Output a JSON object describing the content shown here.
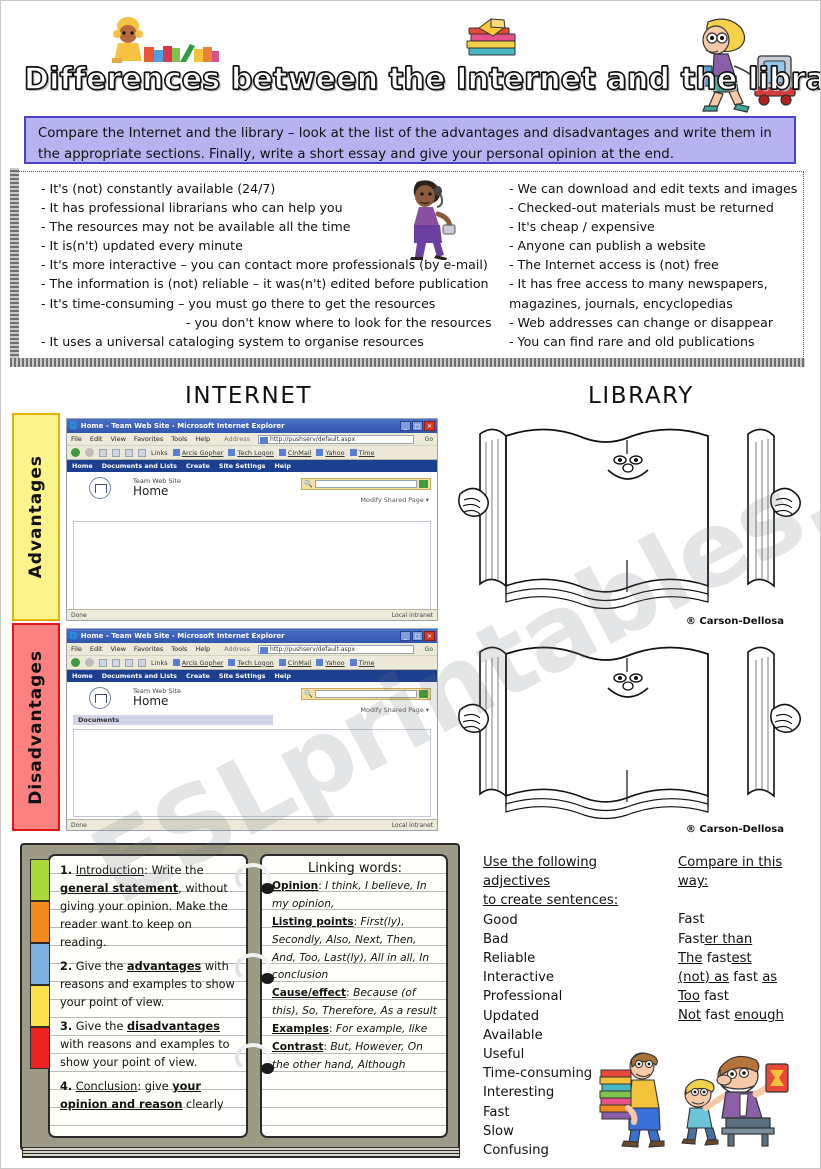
{
  "title": "Differences between the Internet and the library",
  "instructions": "Compare the Internet and the library – look at the list of the advantages and disadvantages and write them in the appropriate sections. Finally, write a short essay and give your personal opinion at the end.",
  "watermark": "ESLprintables.com",
  "board": {
    "left_items": [
      "- It's (not) constantly available (24/7)",
      "- It has professional librarians who can help you",
      "- The resources may not be available all the time",
      "- It is(n't) updated every minute",
      "- It's more interactive – you can contact more professionals (by e-mail)",
      "- The information is (not) reliable – it was(n't) edited before publication",
      "- It's time-consuming – you must go there to get the resources",
      "- you don't know where to look for the resources",
      "- It uses a universal cataloging system to organise resources"
    ],
    "right_items": [
      "- We can download and edit texts and images",
      "- Checked-out materials must be returned",
      "- It's cheap / expensive",
      "- Anyone can publish a  website",
      "- The Internet access is (not) free",
      "- It has free access to many newspapers, magazines, journals, encyclopedias",
      "- Web addresses can change or disappear",
      "- You can find rare and old publications"
    ]
  },
  "sections": {
    "internet_heading": "INTERNET",
    "library_heading": "LIBRARY",
    "advantages_label": "Advantages",
    "disadvantages_label": "Disadvantages"
  },
  "browser": {
    "window_title": "Home - Team Web Site - Microsoft Internet Explorer",
    "minimize": "_",
    "maximize": "□",
    "close": "✕",
    "menu": [
      "File",
      "Edit",
      "View",
      "Favorites",
      "Tools",
      "Help"
    ],
    "address_label": "Address",
    "address_value": "http://pushserv/default.aspx",
    "go_label": "Go",
    "links_label": "Links",
    "toolbar_links": [
      "Arcis Gopher",
      "Tech Logon",
      "CinMail",
      "Yahoo",
      "Time"
    ],
    "nav_items": [
      "Home",
      "Documents and Lists",
      "Create",
      "Site Settings",
      "Help"
    ],
    "site_small": "Team Web Site",
    "site_large": "Home",
    "modify_link": "Modify Shared Page ▾",
    "documents_header": "Documents",
    "status_left": "Done",
    "status_right": "Local intranet"
  },
  "book_credit": "® Carson-Dellosa",
  "notebook": {
    "tab_colors": [
      "#a9d93a",
      "#f08a1e",
      "#7eb0e0",
      "#fce14a",
      "#ef2222"
    ],
    "steps": [
      {
        "num": "1.",
        "lead": "Introduction",
        "text_a": ": Write the ",
        "bold": "general statement",
        "text_b": ", without giving your opinion. Make the reader want to keep on reading."
      },
      {
        "num": "2.",
        "lead": "",
        "text_a": "Give the ",
        "bold": "advantages",
        "text_b": " with reasons and examples to show your point of view."
      },
      {
        "num": "3.",
        "lead": "",
        "text_a": "Give the ",
        "bold": "disadvantages",
        "text_b": " with reasons and examples to show your point of view."
      },
      {
        "num": "4.",
        "lead": "Conclusion",
        "text_a": ": give ",
        "bold": "your opinion and reason",
        "text_b": " clearly"
      }
    ],
    "linking_title": "Linking words:",
    "linking": [
      {
        "label": "Opinion",
        "items": "I think, I believe, In my opinion,"
      },
      {
        "label": "Listing points",
        "items": "First(ly), Secondly, Also, Next, Then, And, Too, Last(ly), All in all, In conclusion"
      },
      {
        "label": "Cause/effect",
        "items": "Because (of this), So, Therefore, As a result"
      },
      {
        "label": "Examples",
        "items": "For example, like"
      },
      {
        "label": "Contrast",
        "items": "But, However, On the other hand, Although"
      }
    ]
  },
  "adjectives": {
    "heading_line1": "Use the following adjectives",
    "heading_line2": "to create sentences:",
    "items": [
      "Good",
      "Bad",
      "Reliable",
      "Interactive",
      "Professional",
      "Updated",
      "Available",
      "Useful",
      "Time-consuming",
      "Interesting",
      "Fast",
      "Slow",
      "Confusing"
    ]
  },
  "compare": {
    "heading_line1": "Compare in this",
    "heading_line2": "way:",
    "items": [
      {
        "pre": "",
        "u1": "",
        "mid": "Fast",
        "u2": "",
        "post": ""
      },
      {
        "pre": "Fast",
        "u1": "er than",
        "mid": "",
        "u2": "",
        "post": ""
      },
      {
        "pre": "",
        "u1": "The",
        "mid": " fast",
        "u2": "est",
        "post": ""
      },
      {
        "pre": "",
        "u1": "(not) as",
        "mid": " fast ",
        "u2": "as",
        "post": ""
      },
      {
        "pre": "",
        "u1": "Too",
        "mid": " fast",
        "u2": "",
        "post": ""
      },
      {
        "pre": "",
        "u1": "Not",
        "mid": " fast ",
        "u2": "enough",
        "post": ""
      }
    ]
  },
  "colors": {
    "instructions_bg": "#b7b3f0",
    "instructions_border": "#4b41c9",
    "advantages_bg": "#fcf38d",
    "advantages_border": "#e2b400",
    "disadvantages_bg": "#fb8181",
    "disadvantages_border": "#e71212",
    "notebook_cover": "#9d9a86"
  }
}
